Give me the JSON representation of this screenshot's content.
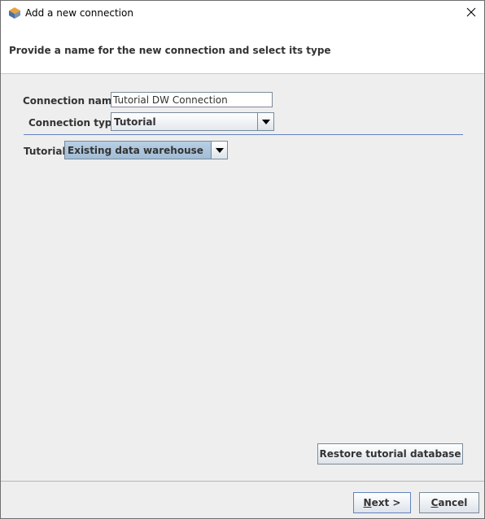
{
  "window": {
    "title": "Add a new connection",
    "app_icon": "app-logo-icon",
    "close_icon": "close-icon"
  },
  "header": {
    "text": "Provide a name for the new connection and select its type"
  },
  "form": {
    "connection_name_label": "Connection name:",
    "connection_name_value": "Tutorial DW Connection",
    "connection_type_label": "Connection type:",
    "connection_type_value": "Tutorial",
    "tutorial_label": "Tutorial:",
    "tutorial_value": "Existing data warehouse"
  },
  "buttons": {
    "restore_label": "Restore tutorial database",
    "next_mnemonic": "N",
    "next_rest": "ext >",
    "cancel_mnemonic": "C",
    "cancel_rest": "ancel"
  },
  "colors": {
    "accent": "#6382bf",
    "selected_combo": "#a3bdd6",
    "background": "#eeeeee"
  }
}
